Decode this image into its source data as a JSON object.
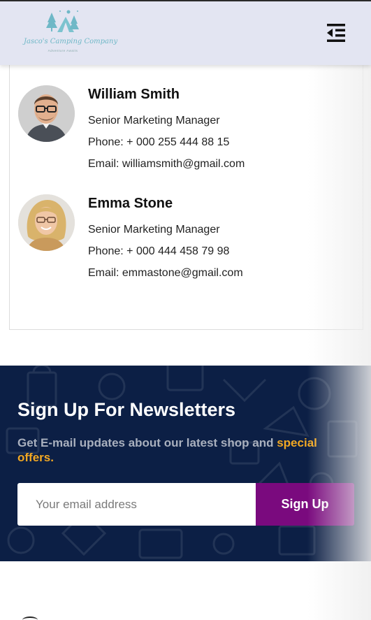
{
  "header": {
    "logo_text": "Jasco's Camping Company",
    "logo_subtext": "Adventure Awaits",
    "menu_icon": "menu-collapse-icon"
  },
  "contacts": [
    {
      "name": "William Smith",
      "role": "Senior Marketing Manager",
      "phone": "Phone: + 000 255 444 88 15",
      "email": "Email: williamsmith@gmail.com"
    },
    {
      "name": "Emma Stone",
      "role": "Senior Marketing Manager",
      "phone": "Phone: + 000 444 458 79 98",
      "email": "Email: emmastone@gmail.com"
    }
  ],
  "newsletter": {
    "title": "Sign Up For Newsletters",
    "text_main": "Get E-mail updates about our latest shop and ",
    "text_highlight": "special offers.",
    "email_placeholder": "Your email address",
    "email_value": "",
    "button_label": "Sign Up"
  },
  "colors": {
    "header_bg": "#e3e5f2",
    "newsletter_bg": "#0c1f45",
    "highlight": "#f2a823",
    "button_bg": "#7a0a7e"
  }
}
